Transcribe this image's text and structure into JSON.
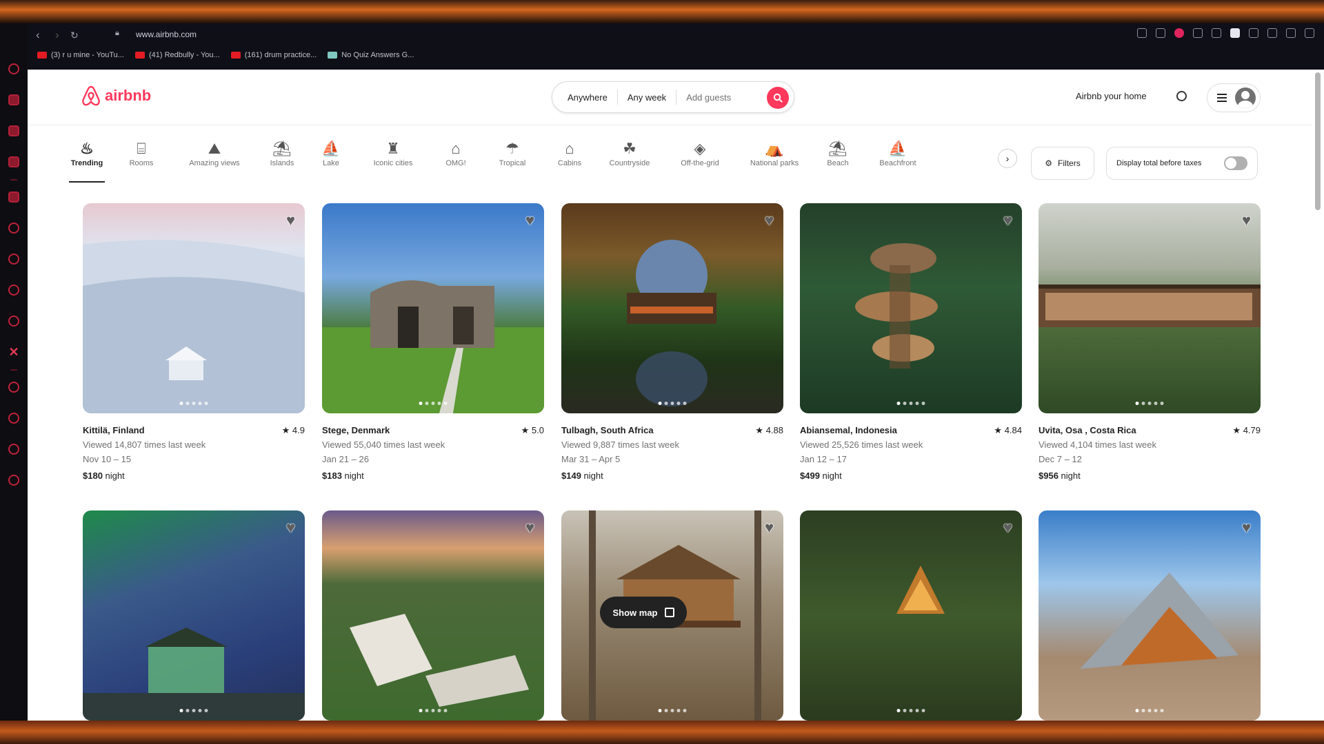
{
  "browser": {
    "url": "www.airbnb.com",
    "bookmarks": [
      "(3) r u mine - YouTu...",
      "(41) Redbully - You...",
      "(161) drum practice...",
      "No Quiz Answers G..."
    ]
  },
  "header": {
    "logo_text": "airbnb",
    "search": {
      "anywhere": "Anywhere",
      "any_week": "Any week",
      "add_guests": "Add guests"
    },
    "host_link": "Airbnb your home"
  },
  "categories": [
    {
      "label": "Trending",
      "icon": "flame-icon",
      "active": true
    },
    {
      "label": "Rooms",
      "icon": "bed-icon"
    },
    {
      "label": "Amazing views",
      "icon": "landscape-icon"
    },
    {
      "label": "Islands",
      "icon": "palm-tree-icon"
    },
    {
      "label": "Lake",
      "icon": "boat-icon"
    },
    {
      "label": "Iconic cities",
      "icon": "tower-icon"
    },
    {
      "label": "OMG!",
      "icon": "ufo-icon"
    },
    {
      "label": "Tropical",
      "icon": "tropical-icon"
    },
    {
      "label": "Cabins",
      "icon": "cabin-icon"
    },
    {
      "label": "Countryside",
      "icon": "countryside-icon"
    },
    {
      "label": "Off-the-grid",
      "icon": "off-grid-icon"
    },
    {
      "label": "National parks",
      "icon": "park-icon"
    },
    {
      "label": "Beach",
      "icon": "umbrella-icon"
    },
    {
      "label": "Beachfront",
      "icon": "beachfront-icon"
    }
  ],
  "filters_label": "Filters",
  "tax_toggle_label": "Display total before taxes",
  "listings": [
    {
      "location": "Kittilä, Finland",
      "rating": "4.9",
      "views": "Viewed 14,807 times last week",
      "dates": "Nov 10 – 15",
      "price": "$180",
      "unit": "night"
    },
    {
      "location": "Stege, Denmark",
      "rating": "5.0",
      "views": "Viewed 55,040 times last week",
      "dates": "Jan 21 – 26",
      "price": "$183",
      "unit": "night"
    },
    {
      "location": "Tulbagh, South Africa",
      "rating": "4.88",
      "views": "Viewed 9,887 times last week",
      "dates": "Mar 31 – Apr 5",
      "price": "$149",
      "unit": "night"
    },
    {
      "location": "Abiansemal, Indonesia",
      "rating": "4.84",
      "views": "Viewed 25,526 times last week",
      "dates": "Jan 12 – 17",
      "price": "$499",
      "unit": "night"
    },
    {
      "location": "Uvita, Osa , Costa Rica",
      "rating": "4.79",
      "views": "Viewed 4,104 times last week",
      "dates": "Dec 7 – 12",
      "price": "$956",
      "unit": "night"
    }
  ],
  "show_map_label": "Show map"
}
